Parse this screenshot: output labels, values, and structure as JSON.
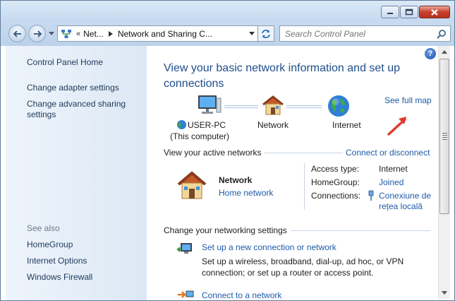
{
  "toolbar": {
    "breadcrumb_prefix": "«",
    "crumb1": "Net...",
    "crumb2": "Network and Sharing C...",
    "search_placeholder": "Search Control Panel"
  },
  "sidebar": {
    "home": "Control Panel Home",
    "links": [
      "Change adapter settings",
      "Change advanced sharing settings"
    ],
    "see_also_title": "See also",
    "see_also": [
      "HomeGroup",
      "Internet Options",
      "Windows Firewall"
    ]
  },
  "main": {
    "heading": "View your basic network information and set up connections",
    "map": {
      "computer_line1": "USER-PC",
      "computer_line2": "(This computer)",
      "network": "Network",
      "internet": "Internet",
      "see_full_map": "See full map"
    },
    "active": {
      "title": "View your active networks",
      "action": "Connect or disconnect",
      "network_name": "Network",
      "network_type": "Home network",
      "access_type_label": "Access type:",
      "access_type_value": "Internet",
      "homegroup_label": "HomeGroup:",
      "homegroup_value": "Joined",
      "connections_label": "Connections:",
      "connection_line1": "Conexiune de",
      "connection_line2": "rețea locală"
    },
    "settings": {
      "title": "Change your networking settings",
      "task1_link": "Set up a new connection or network",
      "task1_desc": "Set up a wireless, broadband, dial-up, ad hoc, or VPN connection; or set up a router or access point.",
      "task2_link": "Connect to a network"
    }
  },
  "colors": {
    "link": "#1e5ba8",
    "heading": "#1e4e8c",
    "sidebar_bg": "#dce8f5",
    "annotation_arrow": "#e23a2e"
  }
}
